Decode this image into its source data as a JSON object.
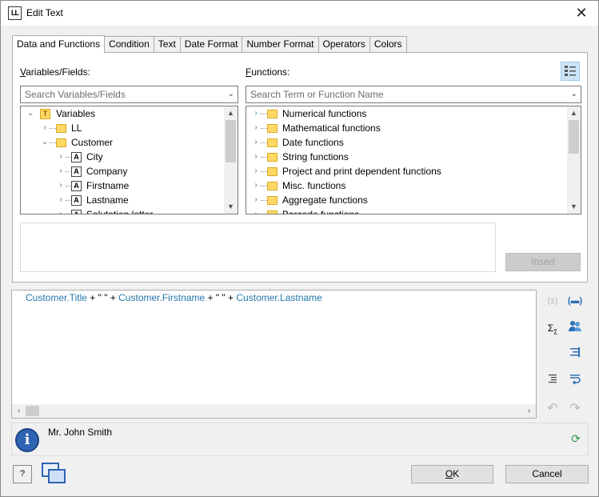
{
  "window": {
    "title": "Edit Text",
    "app_icon": "LL"
  },
  "tabs": [
    "Data and Functions",
    "Condition",
    "Text",
    "Date Format",
    "Number Format",
    "Operators",
    "Colors"
  ],
  "variables": {
    "label_prefix": "V",
    "label_rest": "ariables/Fields:",
    "search_placeholder": "Search Variables/Fields",
    "tree": [
      {
        "label": "Variables",
        "type": "root",
        "expanded": true
      },
      {
        "label": "LL",
        "type": "folder",
        "expanded": false
      },
      {
        "label": "Customer",
        "type": "folder",
        "expanded": true
      },
      {
        "label": "City",
        "type": "field"
      },
      {
        "label": "Company",
        "type": "field"
      },
      {
        "label": "Firstname",
        "type": "field"
      },
      {
        "label": "Lastname",
        "type": "field"
      },
      {
        "label": "Salutation letter",
        "type": "field"
      }
    ]
  },
  "functions": {
    "label_prefix": "F",
    "label_rest": "unctions:",
    "search_placeholder": "Search Term or Function Name",
    "tree": [
      "Numerical functions",
      "Mathematical functions",
      "Date functions",
      "String functions",
      "Project and print dependent functions",
      "Misc. functions",
      "Aggregate functions",
      "Barcode functions"
    ]
  },
  "insert_button": "Insert",
  "expression": {
    "parts": [
      {
        "text": "Customer.Title",
        "kind": "field"
      },
      {
        "text": " + \" \" + ",
        "kind": "op"
      },
      {
        "text": "Customer.Firstname",
        "kind": "field"
      },
      {
        "text": " + \" \" + ",
        "kind": "op"
      },
      {
        "text": "Customer.Lastname",
        "kind": "field"
      }
    ]
  },
  "result": {
    "text": "Mr. John Smith"
  },
  "buttons": {
    "ok_prefix": "O",
    "ok_rest": "K",
    "cancel": "Cancel"
  },
  "colors": {
    "field": "#2277aa",
    "accent": "#2f64b3",
    "folder": "#ffd866"
  }
}
